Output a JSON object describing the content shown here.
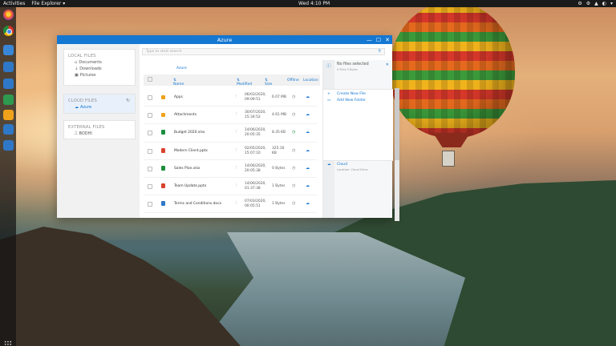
{
  "topbar": {
    "activities": "Activities",
    "app_name": "File Explorer ▾",
    "clock": "Wed 4:10 PM",
    "status_icons": [
      "⚙",
      "⚙",
      "▲",
      "◐",
      "▾"
    ]
  },
  "window": {
    "title": "Azure",
    "controls": {
      "minimize": "—",
      "maximize": "☐",
      "close": "✕"
    }
  },
  "nav": {
    "local_header": "LOCAL FILES",
    "local_items": [
      {
        "icon": "folder-icon",
        "label": "Documents"
      },
      {
        "icon": "download-icon",
        "label": "Downloads"
      },
      {
        "icon": "picture-icon",
        "label": "Pictures"
      }
    ],
    "cloud_header": "CLOUD FILES",
    "cloud_items": [
      {
        "icon": "cloud-icon",
        "label": "Azure"
      }
    ],
    "external_header": "EXTERNAL FILES",
    "external_items": [
      {
        "icon": "usb-icon",
        "label": "BODHI"
      }
    ]
  },
  "main": {
    "search_placeholder": "Type to start search",
    "breadcrumb": "Azure",
    "columns": {
      "name": "Name",
      "modified": "Modified",
      "size": "Size",
      "offline": "Offline",
      "location": "Location"
    },
    "rows": [
      {
        "type": "folder",
        "name": "Apps",
        "date": "06/03/2020,",
        "time": "09:09:51",
        "size": "6.07 MB",
        "offline": "◷",
        "location": "☁"
      },
      {
        "type": "folder",
        "name": "Attachments",
        "date": "30/07/2020,",
        "time": "15:34:52",
        "size": "4.61 MB",
        "offline": "◷",
        "location": "☁"
      },
      {
        "type": "xlsx",
        "name": "Budget 2020.xlsx",
        "date": "14/06/2020,",
        "time": "20:05:35",
        "size": "8.35 KB",
        "offline": "◷",
        "location": "☁"
      },
      {
        "type": "pptx",
        "name": "Modern Client.pptx",
        "date": "02/05/2020,",
        "time": "15:07:10",
        "size": "325.16",
        "size2": "KB",
        "offline": "◷",
        "location": "☁"
      },
      {
        "type": "xlsx",
        "name": "Sales Plan.xlsx",
        "date": "14/06/2020,",
        "time": "20:05:38",
        "size": "0 Bytes",
        "offline": "◷",
        "location": "☁"
      },
      {
        "type": "pptx",
        "name": "Team Update.pptx",
        "date": "14/06/2020,",
        "time": "01:37:38",
        "size": "1 Bytes",
        "offline": "◷",
        "location": "☁"
      },
      {
        "type": "docx",
        "name": "Terms and Conditions.docx",
        "date": "07/03/2020,",
        "time": "00:05:51",
        "size": "1 Bytes",
        "offline": "◷",
        "location": "☁"
      }
    ]
  },
  "details": {
    "title": "No files selected",
    "subtitle": "0 Files 0 Bytes",
    "actions": [
      "Create New File",
      "Add New Folder"
    ],
    "location_label": "Cloud",
    "location_sub": "Location: Cloud Drive"
  }
}
